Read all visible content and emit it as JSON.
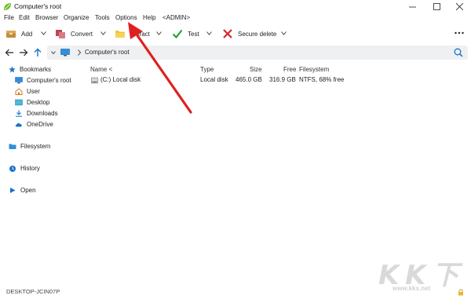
{
  "window": {
    "title": "Computer's root",
    "minimize_icon": "minimize-icon",
    "maximize_icon": "maximize-icon",
    "close_icon": "close-icon"
  },
  "menu": [
    "File",
    "Edit",
    "Browser",
    "Organize",
    "Tools",
    "Options",
    "Help",
    "<ADMIN>"
  ],
  "toolbar": {
    "add": "Add",
    "convert": "Convert",
    "extract": "Extract",
    "test": "Test",
    "secure_delete": "Secure delete"
  },
  "address": {
    "path": "Computer's root"
  },
  "sidebar": {
    "bookmarks": "Bookmarks",
    "computers_root": "Computer's root",
    "user": "User",
    "desktop": "Desktop",
    "downloads": "Downloads",
    "onedrive": "OneDrive",
    "filesystem": "Filesystem",
    "history": "History",
    "open": "Open"
  },
  "columns": {
    "name": "Name <",
    "type": "Type",
    "size": "Size",
    "free": "Free",
    "filesystem": "Filesystem"
  },
  "rows": [
    {
      "name": "(C:) Local disk",
      "type": "Local disk",
      "size": "465.0 GB",
      "free": "316.9 GB",
      "filesystem": "NTFS, 68% free"
    }
  ],
  "status": {
    "computer_name": "DESKTOP-JCIN07P"
  },
  "watermark": {
    "url": "www.kkx.net"
  },
  "colors": {
    "accent_blue": "#1a73c8",
    "annotation_red": "#e02020",
    "toolbar_green": "#23a23a",
    "toolbar_red": "#d9262c",
    "folder_yellow": "#f2c23a"
  }
}
